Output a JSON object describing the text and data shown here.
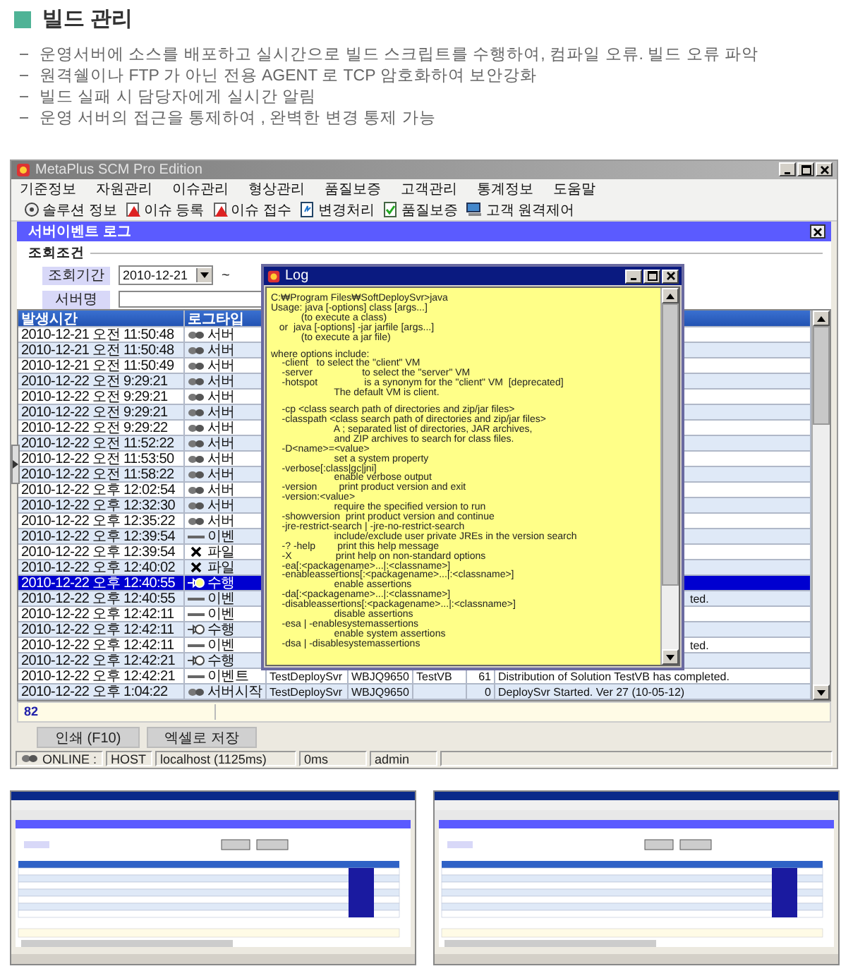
{
  "section": {
    "title": "빌드 관리",
    "bullets": [
      "운영서버에 소스를 배포하고 실시간으로 빌드 스크립트를 수행하여, 컴파일 오류. 빌드 오류 파악",
      "원격쉘이나 FTP 가 아닌 전용 AGENT 로 TCP 암호화하여 보안강화",
      "빌드 실패 시 담당자에게 실시간 알림",
      "운영 서버의 접근을 통제하여 , 완벽한 변경 통제 가능"
    ]
  },
  "app": {
    "title": "MetaPlus SCM Pro Edition",
    "menu": [
      "기준정보",
      "자원관리",
      "이슈관리",
      "형상관리",
      "품질보증",
      "고객관리",
      "통계정보",
      "도움말"
    ],
    "toolbar": [
      {
        "kind": "disc",
        "label": "솔루션 정보"
      },
      {
        "kind": "warning",
        "label": "이슈 등록"
      },
      {
        "kind": "warning",
        "label": "이슈 접수"
      },
      {
        "kind": "document",
        "label": "변경처리"
      },
      {
        "kind": "check",
        "label": "품질보증"
      },
      {
        "kind": "computer",
        "label": "고객 원격제어"
      }
    ],
    "panel_title": "서버이벤트 로그",
    "search": {
      "group": "조회조건",
      "period_label": "조회기간",
      "date_from": "2010-12-21",
      "separator": "~",
      "server_label": "서버명"
    },
    "table": {
      "columns": [
        "발생시간",
        "로그타입"
      ],
      "rows": [
        {
          "time": "2010-12-21 오전 11:50:48",
          "kind": "start",
          "type": "서버",
          "selected": false
        },
        {
          "time": "2010-12-21 오전 11:50:48",
          "kind": "start",
          "type": "서버",
          "selected": false
        },
        {
          "time": "2010-12-21 오전 11:50:49",
          "kind": "start",
          "type": "서버",
          "selected": false
        },
        {
          "time": "2010-12-22 오전 9:29:21",
          "kind": "start",
          "type": "서버",
          "selected": false
        },
        {
          "time": "2010-12-22 오전 9:29:21",
          "kind": "start",
          "type": "서버",
          "selected": false
        },
        {
          "time": "2010-12-22 오전 9:29:21",
          "kind": "start",
          "type": "서버",
          "selected": false
        },
        {
          "time": "2010-12-22 오전 9:29:22",
          "kind": "start",
          "type": "서버",
          "selected": false
        },
        {
          "time": "2010-12-22 오전 11:52:22",
          "kind": "start",
          "type": "서버",
          "selected": false
        },
        {
          "time": "2010-12-22 오전 11:53:50",
          "kind": "start",
          "type": "서버",
          "selected": false
        },
        {
          "time": "2010-12-22 오전 11:58:22",
          "kind": "start",
          "type": "서버",
          "selected": false
        },
        {
          "time": "2010-12-22 오후 12:02:54",
          "kind": "start",
          "type": "서버",
          "selected": false
        },
        {
          "time": "2010-12-22 오후 12:32:30",
          "kind": "start",
          "type": "서버",
          "selected": false
        },
        {
          "time": "2010-12-22 오후 12:35:22",
          "kind": "start",
          "type": "서버",
          "selected": false
        },
        {
          "time": "2010-12-22 오후 12:39:54",
          "kind": "event",
          "type": "이벤",
          "selected": false
        },
        {
          "time": "2010-12-22 오후 12:39:54",
          "kind": "error",
          "type": "파일",
          "selected": false
        },
        {
          "time": "2010-12-22 오후 12:40:02",
          "kind": "error",
          "type": "파일",
          "selected": false
        },
        {
          "time": "2010-12-22 오후 12:40:55",
          "kind": "run",
          "type": "수행",
          "selected": true
        },
        {
          "time": "2010-12-22 오후 12:40:55",
          "kind": "event",
          "type": "이벤",
          "selected": false,
          "message": "ted."
        },
        {
          "time": "2010-12-22 오후 12:42:11",
          "kind": "event",
          "type": "이벤",
          "selected": false
        },
        {
          "time": "2010-12-22 오후 12:42:11",
          "kind": "run",
          "type": "수행",
          "selected": false
        },
        {
          "time": "2010-12-22 오후 12:42:11",
          "kind": "event",
          "type": "이벤",
          "selected": false,
          "message": "ted."
        },
        {
          "time": "2010-12-22 오후 12:42:21",
          "kind": "run",
          "type": "수행",
          "selected": false
        },
        {
          "time": "2010-12-22 오후 12:42:21",
          "kind": "event",
          "type": "이벤트",
          "selected": false,
          "server": "TestDeploySvr",
          "host": "WBJQ9650",
          "solution": "TestVB",
          "count": "61",
          "message": "Distribution of Solution TestVB has completed."
        },
        {
          "time": "2010-12-22 오후 1:04:22",
          "kind": "start",
          "type": "서버시작",
          "selected": false,
          "server": "TestDeploySvr",
          "host": "WBJQ9650",
          "count": "0",
          "message": "DeploySvr Started. Ver 27 (10-05-12)"
        }
      ]
    },
    "count": "82",
    "buttons": [
      "인쇄 (F10)",
      "엑셀로 저장"
    ],
    "status_bar": {
      "online": "ONLINE :",
      "host_label": "HOST",
      "host": "localhost (1125ms)",
      "latency": "0ms",
      "user": "admin"
    }
  },
  "log_window": {
    "title": "Log",
    "blocks": [
      [
        "C:₩Program Files₩SoftDeploySvr>java",
        "Usage: java [-options] class [args...]",
        "           (to execute a class)",
        "   or  java [-options] -jar jarfile [args...]",
        "           (to execute a jar file)"
      ],
      [
        "where options include:",
        "    -client   to select the \"client\" VM",
        "    -server                  to select the \"server\" VM",
        "    -hotspot                 is a synonym for the \"client\" VM  [deprecated]",
        "                       The default VM is client."
      ],
      [
        "    -cp <class search path of directories and zip/jar files>",
        "    -classpath <class search path of directories and zip/jar files>",
        "                       A ; separated list of directories, JAR archives,",
        "                       and ZIP archives to search for class files.",
        "    -D<name>=<value>",
        "                       set a system property",
        "    -verbose[:class|gc|jni]",
        "                       enable verbose output",
        "    -version        print product version and exit",
        "    -version:<value>",
        "                       require the specified version to run",
        "    -showversion  print product version and continue",
        "    -jre-restrict-search | -jre-no-restrict-search",
        "                       include/exclude user private JREs in the version search",
        "    -? -help        print this help message",
        "    -X                print help on non-standard options",
        "    -ea[:<packagename>...|:<classname>]",
        "    -enableassertions[:<packagename>...|:<classname>]",
        "                       enable assertions",
        "    -da[:<packagename>...|:<classname>]",
        "    -disableassertions[:<packagename>...|:<classname>]",
        "                       disable assertions",
        "    -esa | -enablesystemassertions",
        "                       enable system assertions",
        "    -dsa | -disablesystemassertions"
      ]
    ]
  },
  "thumbnails": [
    {
      "kind": "screenshot"
    },
    {
      "kind": "screenshot"
    }
  ]
}
